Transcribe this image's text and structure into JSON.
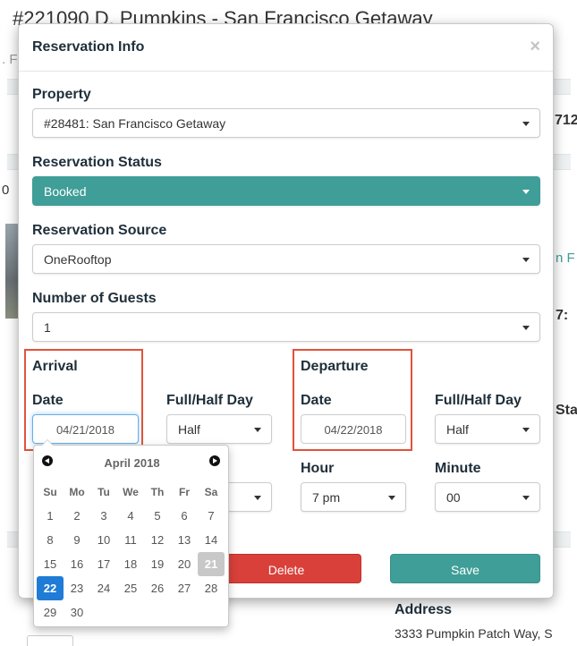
{
  "background": {
    "page_title": "#221090 D. Pumpkins - San Francisco Getaway",
    "left_letters": [
      ". F",
      "0"
    ],
    "right_fragments": {
      "num": "712",
      "link": "n F",
      "num2": "7:",
      "sta": "Sta"
    },
    "address_label": "Address",
    "address_value": "3333 Pumpkin Patch Way, S"
  },
  "modal": {
    "title": "Reservation Info",
    "close_glyph": "×",
    "property": {
      "label": "Property",
      "value": "#28481: San Francisco Getaway"
    },
    "status": {
      "label": "Reservation Status",
      "value": "Booked",
      "color": "#3f9e97"
    },
    "source": {
      "label": "Reservation Source",
      "value": "OneRooftop"
    },
    "guests": {
      "label": "Number of Guests",
      "value": "1"
    },
    "arrival": {
      "heading": "Arrival",
      "date_label": "Date",
      "date_value": "04/21/2018",
      "day_label": "Full/Half Day",
      "day_value": "Half"
    },
    "departure": {
      "heading": "Departure",
      "date_label": "Date",
      "date_value": "04/22/2018",
      "day_label": "Full/Half Day",
      "day_value": "Half",
      "hour_label": "Hour",
      "hour_value": "7 pm",
      "minute_label": "Minute",
      "minute_value": "00"
    },
    "buttons": {
      "delete": "Delete",
      "save": "Save"
    },
    "highlight_color": "#e0533b"
  },
  "datepicker": {
    "month": "April 2018",
    "weekdays": [
      "Su",
      "Mo",
      "Tu",
      "We",
      "Th",
      "Fr",
      "Sa"
    ],
    "today": "21",
    "selected": "22",
    "weeks": [
      [
        "1",
        "2",
        "3",
        "4",
        "5",
        "6",
        "7"
      ],
      [
        "8",
        "9",
        "10",
        "11",
        "12",
        "13",
        "14"
      ],
      [
        "15",
        "16",
        "17",
        "18",
        "19",
        "20",
        "21"
      ],
      [
        "22",
        "23",
        "24",
        "25",
        "26",
        "27",
        "28"
      ],
      [
        "29",
        "30",
        "",
        "",
        "",
        "",
        ""
      ]
    ]
  }
}
